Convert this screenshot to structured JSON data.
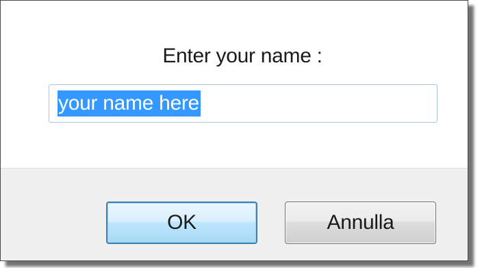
{
  "dialog": {
    "prompt_label": "Enter your name :",
    "name_input": {
      "value": "your name here",
      "selected": true
    },
    "buttons": {
      "ok_label": "OK",
      "cancel_label": "Annulla"
    }
  },
  "colors": {
    "selection": "#3399ff",
    "footer_bg": "#f0f0f0",
    "ok_border": "#3c7fb1"
  }
}
